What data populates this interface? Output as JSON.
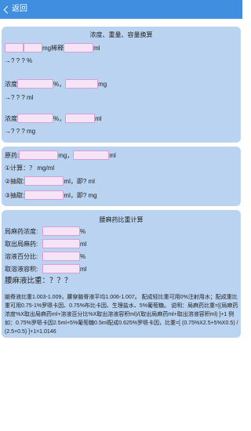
{
  "topbar": {
    "back_label": "返回",
    "bg": "#3f8ee0"
  },
  "panel1": {
    "title": "浓度、重量、容量换算",
    "row1": {
      "unit1": "mg稀释",
      "unit2": "ml"
    },
    "result1": "→? ? ? %",
    "row2": {
      "label": "浓度",
      "unit1": "%，",
      "unit2": "mg"
    },
    "result2": "→? ? ? ml",
    "row3": {
      "label": "浓度",
      "unit1": "%，",
      "unit2": "ml"
    },
    "result3": "→? ? ? mg"
  },
  "panel2": {
    "row1": {
      "label": "原药:",
      "unit1": "mg，",
      "unit2": "ml"
    },
    "line1": "①计算：？ mg/ml",
    "row2": {
      "label": "②抽取:",
      "unit": "ml，即? ml"
    },
    "row3": {
      "label": "③抽取:",
      "unit": "ml，即? mg"
    }
  },
  "panel3": {
    "title": "腰麻药比重计算",
    "fields": [
      {
        "label": "局麻药浓度:",
        "unit": "%"
      },
      {
        "label": "取出局麻药:",
        "unit": "ml"
      },
      {
        "label": "溶液百分比:",
        "unit": "%"
      },
      {
        "label": "取溶液容积:",
        "unit": "ml"
      }
    ],
    "result": "腰麻液比重：？？？",
    "note": "脑脊液比重1.003-1.009，腰穿脑脊液平均1.006-1.007。 配成轻比重可用0%注射用水；配成重比重可用0.75-1%罗哌卡因、0.75%布比卡因、生理盐水、5%葡萄糖。 说明：局麻药比重=[(局麻药浓度%X取出局麻药ml+溶液百分比%X取出溶液容积ml)/(取出局麻药ml+取出溶液容积ml) ]+1 例如：0.75%罗哌卡因2.5ml+5%葡萄糖0.5ml配成0.625%罗哌卡因，比重=[ (0.75%X2.5+5%X0.5) / (2.5+0.5) ]+1=1.0146"
  }
}
